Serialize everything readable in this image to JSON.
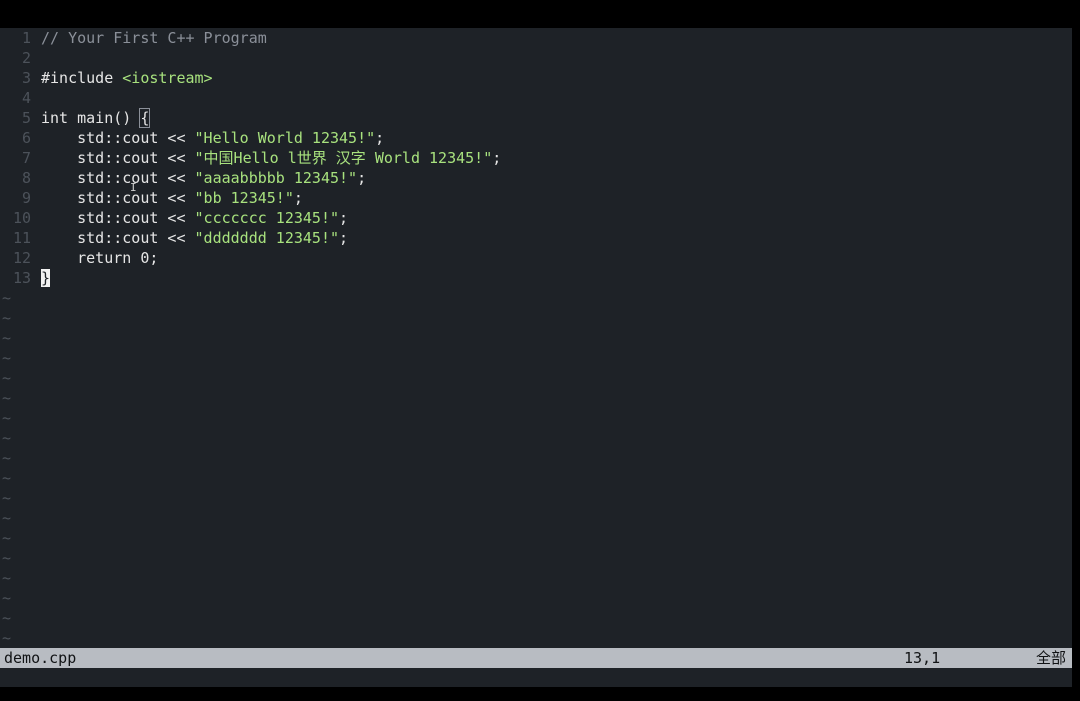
{
  "editor": {
    "lines": [
      {
        "num": "1",
        "text": "// Your First C++ Program",
        "type": "comment"
      },
      {
        "num": "2",
        "text": "",
        "type": "blank"
      },
      {
        "num": "3",
        "pre": "#include ",
        "str": "<iostream>",
        "type": "include"
      },
      {
        "num": "4",
        "text": "",
        "type": "blank"
      },
      {
        "num": "5",
        "pre": "int main() ",
        "bracket": "{",
        "type": "main"
      },
      {
        "num": "6",
        "pre": "    std::cout << ",
        "str": "\"Hello World 12345!\"",
        "post": ";",
        "type": "cout"
      },
      {
        "num": "7",
        "pre": "    std::cout << ",
        "str": "\"中国Hello l世界 汉字 World 12345!\"",
        "post": ";",
        "type": "cout"
      },
      {
        "num": "8",
        "pre": "    std::cout << ",
        "str": "\"aaaabbbbb 12345!\"",
        "post": ";",
        "type": "cout"
      },
      {
        "num": "9",
        "pre": "    std::cout << ",
        "str": "\"bb 12345!\"",
        "post": ";",
        "type": "cout"
      },
      {
        "num": "10",
        "pre": "    std::cout << ",
        "str": "\"ccccccc 12345!\"",
        "post": ";",
        "type": "cout"
      },
      {
        "num": "11",
        "pre": "    std::cout << ",
        "str": "\"ddddddd 12345!\"",
        "post": ";",
        "type": "cout"
      },
      {
        "num": "12",
        "text": "    return 0;",
        "type": "plain"
      },
      {
        "num": "13",
        "cursor": "}",
        "type": "cursor"
      }
    ],
    "tilde_glyph": "~",
    "tilde_count": 18
  },
  "statusbar": {
    "filename": "demo.cpp",
    "position": "13,1",
    "scroll": "全部"
  },
  "colors": {
    "background": "#1e2227",
    "string": "#a8e27e",
    "line_number": "#4c525a",
    "statusbar": "#b8bcc2"
  }
}
